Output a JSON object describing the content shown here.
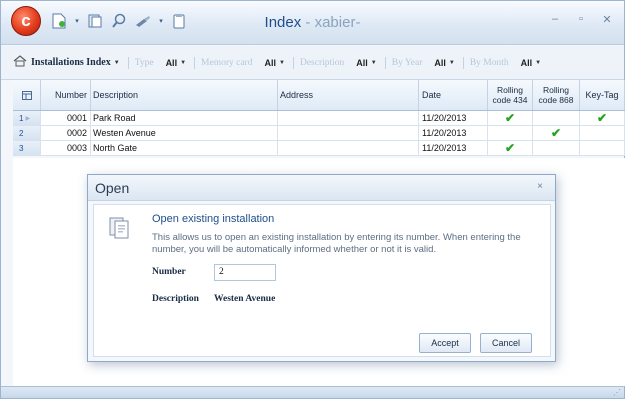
{
  "window": {
    "title": "Index",
    "title_sep": " - ",
    "user": "xabier-",
    "controls": [
      "–",
      "▫",
      "✕"
    ]
  },
  "toolbar": {
    "index_label": "Installations Index",
    "filters": [
      {
        "label": "Type",
        "value": "All"
      },
      {
        "label": "Memory card",
        "value": "All"
      },
      {
        "label": "Description",
        "value": "All"
      },
      {
        "label": "By Year",
        "value": "All"
      },
      {
        "label": "By Month",
        "value": "All"
      }
    ]
  },
  "grid": {
    "columns": {
      "number": "Number",
      "description": "Description",
      "address": "Address",
      "date": "Date",
      "rolling434": "Rolling code 434",
      "rolling868": "Rolling code 868",
      "keytag": "Key-Tag"
    },
    "rows": [
      {
        "idx": "1",
        "number": "0001",
        "description": "Park Road",
        "address": "",
        "date": "11/20/2013",
        "r434": true,
        "r868": false,
        "keytag": true
      },
      {
        "idx": "2",
        "number": "0002",
        "description": "Westen Avenue",
        "address": "",
        "date": "11/20/2013",
        "r434": false,
        "r868": true,
        "keytag": false
      },
      {
        "idx": "3",
        "number": "0003",
        "description": "North Gate",
        "address": "",
        "date": "11/20/2013",
        "r434": true,
        "r868": false,
        "keytag": false
      }
    ]
  },
  "dialog": {
    "title": "Open",
    "close": "×",
    "heading": "Open existing installation",
    "text": "This allows us to open an existing installation by entering its number. When entering the number, you will be automatically informed whether or not it is valid.",
    "number_label": "Number",
    "number_value": "2",
    "description_label": "Description",
    "description_value": "Westen Avenue",
    "accept": "Accept",
    "cancel": "Cancel"
  },
  "colors": {
    "accent": "#1e4f8c",
    "check": "#22a51f",
    "orb": "#e23c1c"
  },
  "icons": [
    "app-orb-icon",
    "new-document-icon",
    "open-icon",
    "search-icon",
    "tools-icon",
    "clipboard-icon",
    "home-icon",
    "grid-corner-icon",
    "check-icon",
    "open-installation-icon",
    "resize-grip-icon"
  ]
}
